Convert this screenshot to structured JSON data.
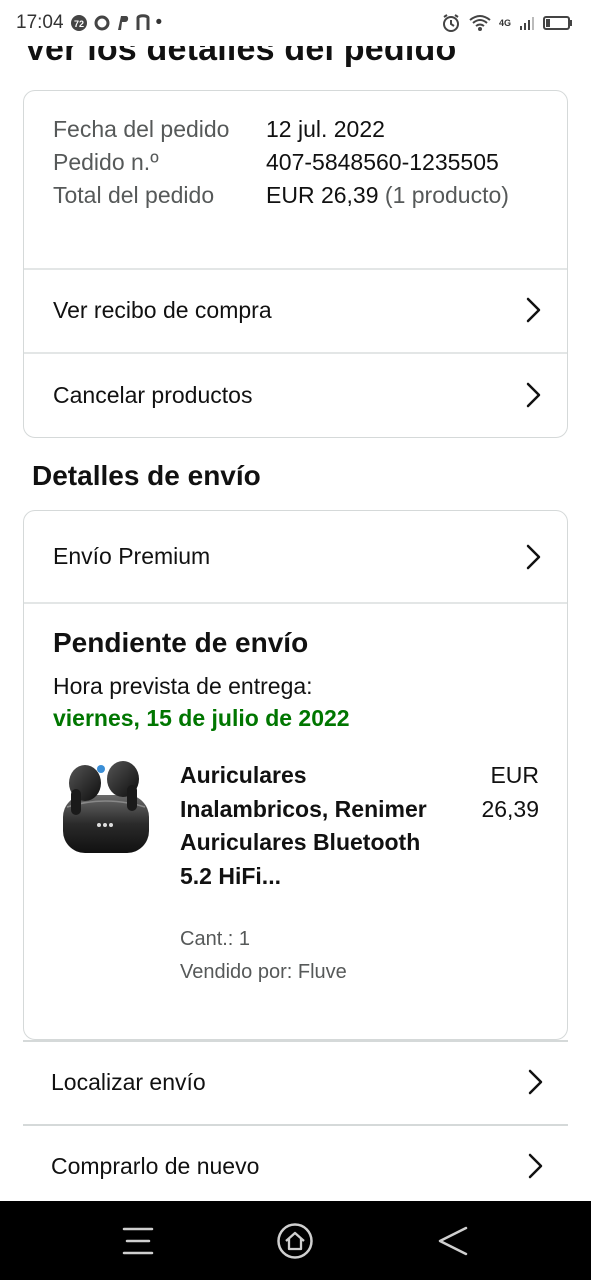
{
  "status_bar": {
    "time": "17:04",
    "app_icons": [
      "notification-badge-icon",
      "o-icon",
      "paypal-icon",
      "n-icon"
    ],
    "dot": "•",
    "network": "4G"
  },
  "page": {
    "title": "Ver los detalles del pedido"
  },
  "order_summary": {
    "date_label": "Fecha del pedido",
    "date_value": "12 jul. 2022",
    "number_label": "Pedido n.º",
    "number_value": "407-5848560-1235505",
    "total_label": "Total del pedido",
    "total_value": "EUR 26,39",
    "total_items": "(1 producto)"
  },
  "order_actions": {
    "receipt": "Ver recibo de compra",
    "cancel": "Cancelar productos"
  },
  "shipping": {
    "section_title": "Detalles de envío",
    "method": "Envío Premium",
    "status": "Pendiente de envío",
    "eta_label": "Hora prevista de entrega:",
    "eta_date": "viernes, 15 de julio de 2022",
    "accent_color": "#007600"
  },
  "product": {
    "title": "Auriculares Inalambricos, Renimer Auriculares Bluetooth 5.2 HiFi...",
    "price": "EUR 26,39",
    "qty": "Cant.: 1",
    "seller": "Vendido por: Fluve"
  },
  "more_actions": {
    "track": "Localizar envío",
    "buy_again": "Comprarlo de nuevo"
  },
  "nav": {
    "buttons": [
      "menu-icon",
      "home-icon",
      "back-icon"
    ]
  }
}
